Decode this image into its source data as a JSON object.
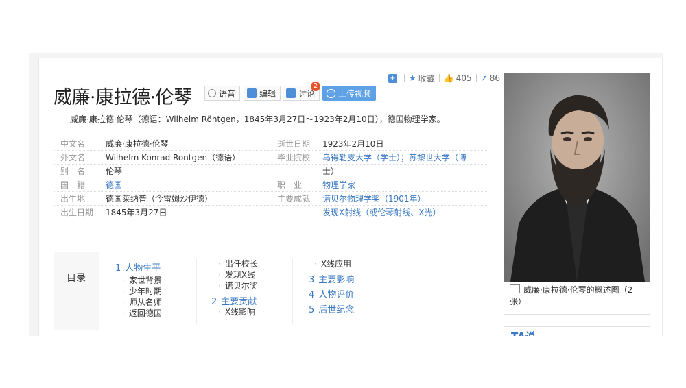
{
  "header": {
    "title": "威廉·康拉德·伦琴",
    "voice_label": "语音",
    "edit_label": "编辑",
    "discuss_label": "讨论",
    "discuss_badge": "2",
    "upload_label": "上传视频"
  },
  "toolbar": {
    "favorite_label": "收藏",
    "likes": "405",
    "shares": "86"
  },
  "summary": "威廉·康拉德·伦琴（德语：Wilhelm Röntgen，1845年3月27日～1923年2月10日），德国物理学家。",
  "basic_info": {
    "left": [
      {
        "key": "中文名",
        "value": "威廉·康拉德·伦琴"
      },
      {
        "key": "外文名",
        "value": "Wilhelm Konrad Rontgen（德语）"
      },
      {
        "key": "别　名",
        "value": "伦琴"
      },
      {
        "key": "国　籍",
        "value": "德国"
      },
      {
        "key": "出生地",
        "value": "德国莱纳普（今雷姆沙伊德）"
      },
      {
        "key": "出生日期",
        "value": "1845年3月27日"
      }
    ],
    "right": [
      {
        "key": "逝世日期",
        "value": "1923年2月10日"
      },
      {
        "key": "毕业院校",
        "value": "乌得勒支大学（学士）；苏黎世大学（博",
        "value2": "士）"
      },
      {
        "key": "职　业",
        "value": "物理学家"
      },
      {
        "key": "主要成就",
        "value": "诺贝尔物理学奖（1901年）",
        "value2": "发现X射线（或伦琴射线、X光）"
      }
    ]
  },
  "toc": {
    "label": "目录",
    "col1": [
      {
        "num": "1",
        "text": "人物生平",
        "level": 1
      },
      {
        "text": "家世背景",
        "level": 2
      },
      {
        "text": "少年时期",
        "level": 2
      },
      {
        "text": "师从名师",
        "level": 2
      },
      {
        "text": "返回德国",
        "level": 2
      }
    ],
    "col2": [
      {
        "text": "出任校长",
        "level": 2
      },
      {
        "text": "发现X线",
        "level": 2
      },
      {
        "text": "诺贝尔奖",
        "level": 2
      },
      {
        "num": "2",
        "text": "主要贡献",
        "level": 1
      },
      {
        "text": "X线影响",
        "level": 2
      }
    ],
    "col3": [
      {
        "text": "X线应用",
        "level": 2
      },
      {
        "num": "3",
        "text": "主要影响",
        "level": 1
      },
      {
        "num": "4",
        "text": "人物评价",
        "level": 1
      },
      {
        "num": "5",
        "text": "后世纪念",
        "level": 1
      }
    ]
  },
  "sidebar": {
    "caption": "威廉·康拉德·伦琴的概述图（2张）",
    "ta_label": "TA说"
  },
  "colors": {
    "link": "#3a78c3",
    "upload": "#5ea1e6",
    "badge": "#e2542a"
  }
}
